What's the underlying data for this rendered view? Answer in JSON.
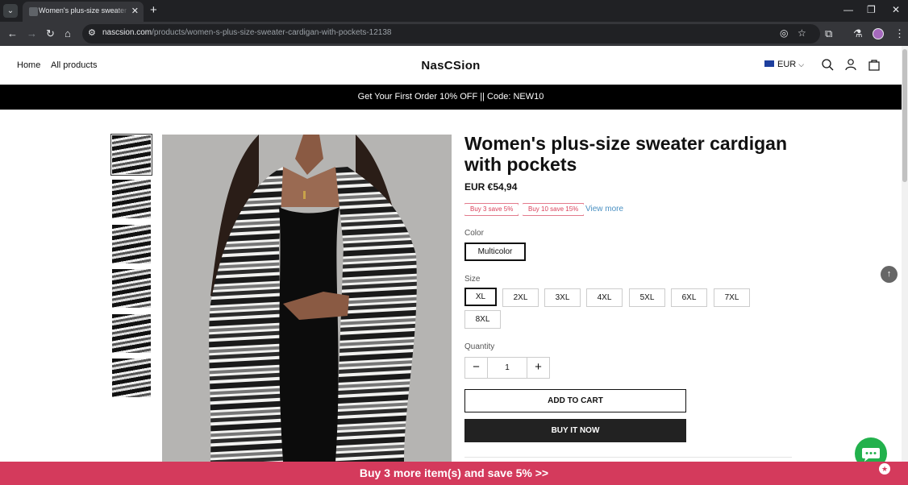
{
  "browser": {
    "tab_title": "Women's plus-size sweater cardigan with pockets",
    "url_host": "nascsion.com",
    "url_path": "/products/women-s-plus-size-sweater-cardigan-with-pockets-12138"
  },
  "header": {
    "nav_home": "Home",
    "nav_all_products": "All products",
    "brand": "NasCSion",
    "currency": "EUR"
  },
  "announcement": "Get Your First Order 10% OFF || Code: NEW10",
  "product": {
    "title": "Women's plus-size sweater cardigan with pockets",
    "price": "EUR €54,94",
    "promos": [
      "Buy 3 save 5%",
      "Buy 10 save 15%"
    ],
    "view_more": "View more",
    "color_label": "Color",
    "color_value": "Multicolor",
    "size_label": "Size",
    "sizes": [
      "XL",
      "2XL",
      "3XL",
      "4XL",
      "5XL",
      "6XL",
      "7XL",
      "8XL"
    ],
    "selected_size": "XL",
    "quantity_label": "Quantity",
    "quantity": "1",
    "add_to_cart": "ADD TO CART",
    "buy_now": "BUY IT NOW"
  },
  "gallery": {
    "thumbnail_count": 6,
    "active_index": 0
  },
  "bottom_bar": "Buy 3 more item(s) and save 5%  >>",
  "colors": {
    "announcement_bg": "#000000",
    "bottom_bar_bg": "#d43a5c",
    "promo_red": "#d9415b",
    "link_blue": "#4a90c2",
    "chat_green": "#22b14c"
  }
}
